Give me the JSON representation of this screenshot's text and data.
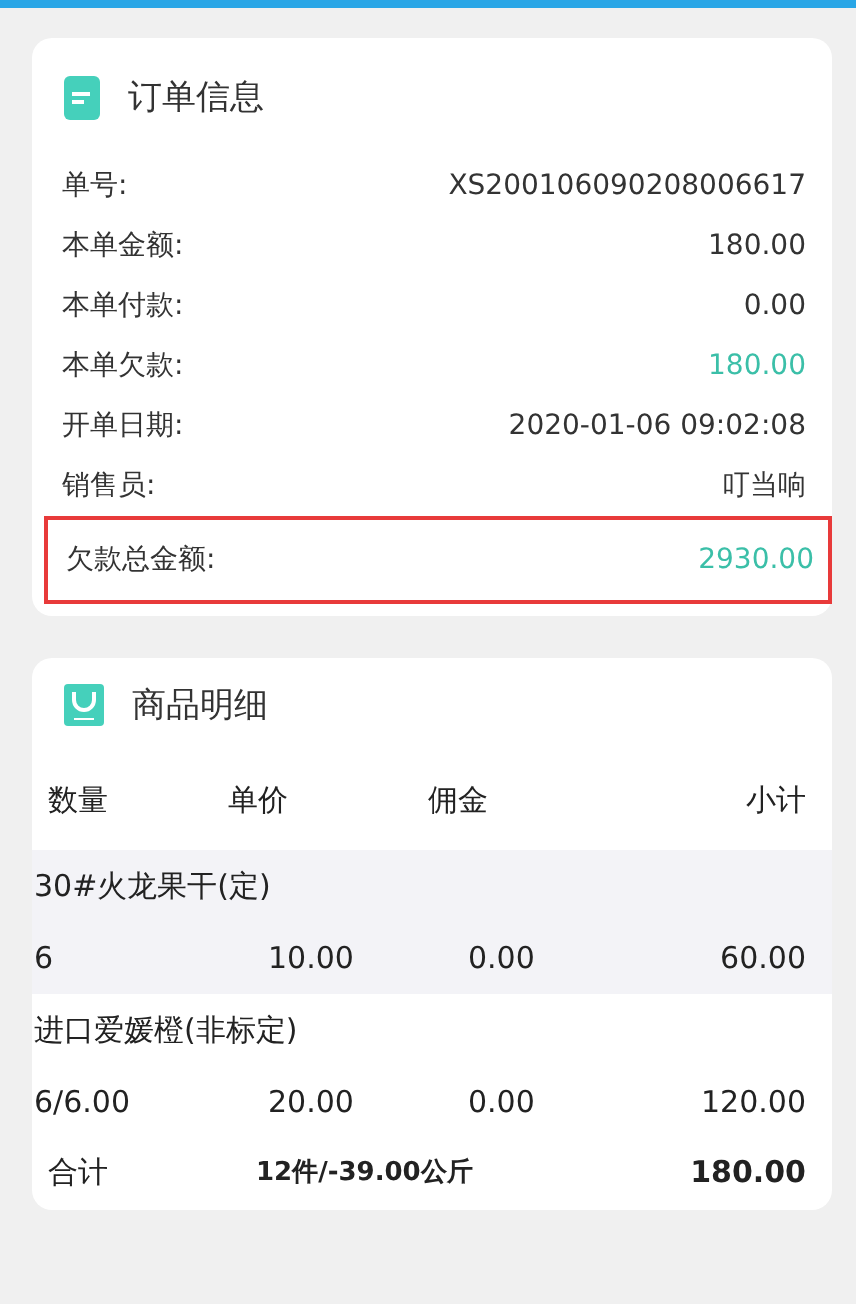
{
  "order_info": {
    "title": "订单信息",
    "rows": [
      {
        "label": "单号:",
        "value": "XS200106090208006617",
        "accent": false,
        "highlight": false
      },
      {
        "label": "本单金额:",
        "value": "180.00",
        "accent": false,
        "highlight": false
      },
      {
        "label": "本单付款:",
        "value": "0.00",
        "accent": false,
        "highlight": false
      },
      {
        "label": "本单欠款:",
        "value": "180.00",
        "accent": true,
        "highlight": false
      },
      {
        "label": "开单日期:",
        "value": "2020-01-06 09:02:08",
        "accent": false,
        "highlight": false
      },
      {
        "label": "销售员:",
        "value": "叮当响",
        "accent": false,
        "highlight": false
      },
      {
        "label": "欠款总金额:",
        "value": "2930.00",
        "accent": true,
        "highlight": true
      }
    ]
  },
  "product_details": {
    "title": "商品明细",
    "columns": [
      "数量",
      "单价",
      "佣金",
      "小计"
    ],
    "items": [
      {
        "name": "30#火龙果干(定)",
        "quantity": "6",
        "unit_price": "10.00",
        "commission": "0.00",
        "subtotal": "60.00",
        "shaded": true
      },
      {
        "name": "进口爱媛橙(非标定)",
        "quantity": "6/6.00",
        "unit_price": "20.00",
        "commission": "0.00",
        "subtotal": "120.00",
        "shaded": false
      }
    ],
    "total": {
      "label": "合计",
      "quantity": "12件/-39.00公斤",
      "amount": "180.00"
    }
  }
}
